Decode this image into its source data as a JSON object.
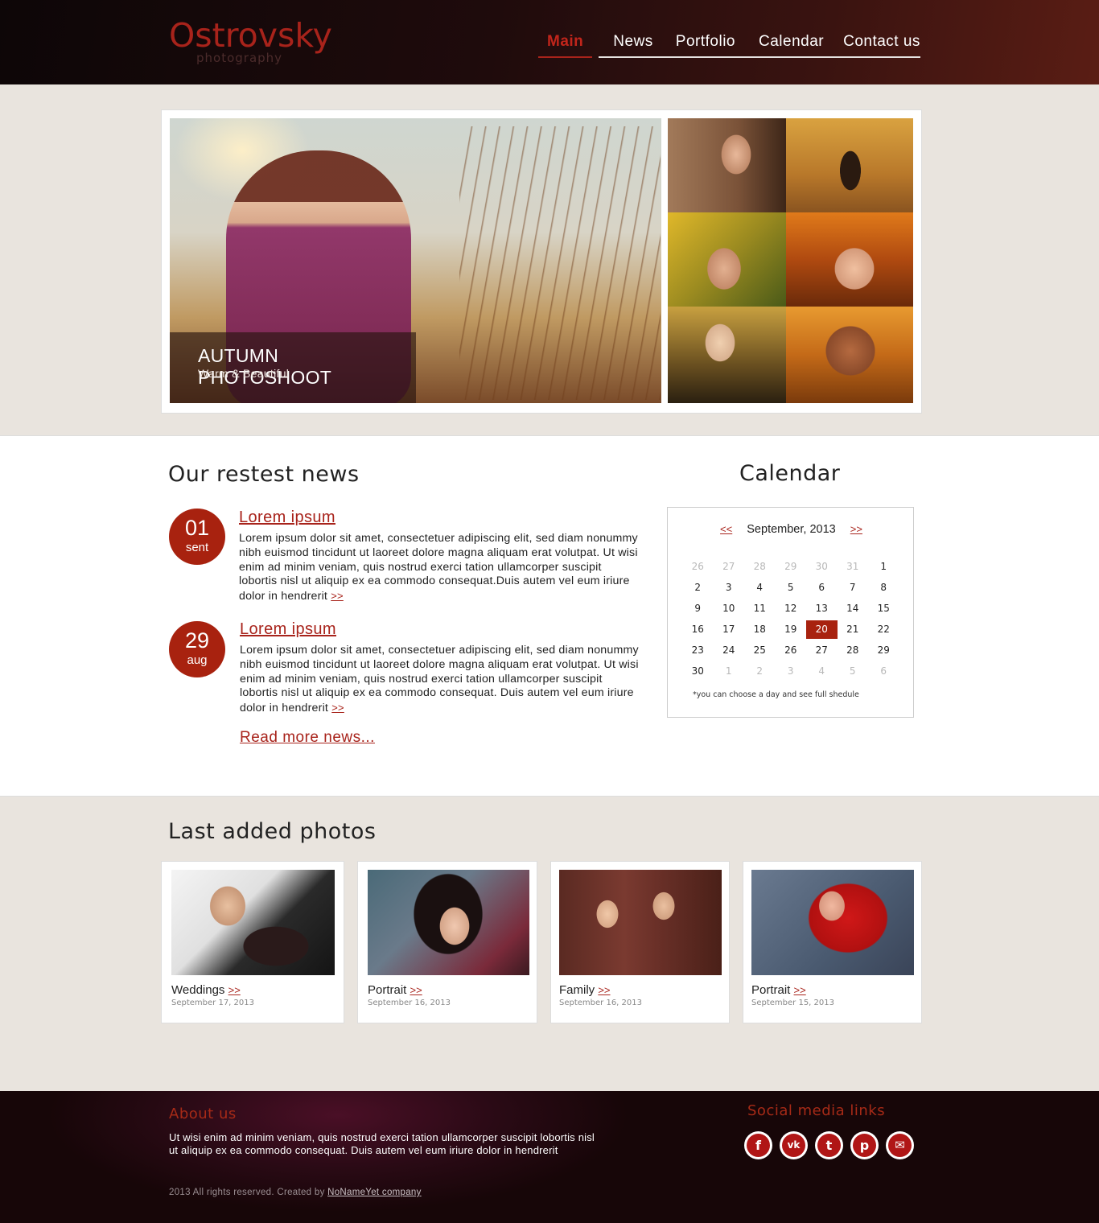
{
  "brand": {
    "name": "Ostrovsky",
    "tagline": "photography"
  },
  "nav": {
    "items": [
      {
        "label": "Main"
      },
      {
        "label": "News"
      },
      {
        "label": "Portfolio"
      },
      {
        "label": "Calendar"
      },
      {
        "label": "Contact us"
      }
    ],
    "active": "Main"
  },
  "hero": {
    "title": "AUTUMN PHOTOSHOOT",
    "subtitle": "Warm & Beautiful"
  },
  "news": {
    "heading": "Our restest news",
    "items": [
      {
        "day": "01",
        "month": "sent",
        "title": "Lorem ipsum",
        "body": "Lorem ipsum dolor sit amet, consectetuer adipiscing elit, sed diam nonummy nibh euismod tincidunt ut laoreet dolore magna aliquam erat volutpat. Ut wisi enim ad minim veniam, quis nostrud exerci tation ullamcorper suscipit lobortis nisl ut aliquip ex ea commodo consequat.Duis autem vel eum iriure dolor in hendrerit",
        "more": ">>"
      },
      {
        "day": "29",
        "month": "aug",
        "title": "Lorem ipsum",
        "body": "Lorem ipsum dolor sit amet, consectetuer adipiscing elit, sed diam nonummy nibh euismod tincidunt ut laoreet dolore magna aliquam erat volutpat. Ut wisi enim ad minim veniam, quis nostrud exerci tation ullamcorper suscipit lobortis nisl ut aliquip ex ea commodo consequat. Duis autem vel eum iriure dolor in hendrerit",
        "more": ">>"
      }
    ],
    "read_more": "Read more news..."
  },
  "calendar": {
    "heading": "Calendar",
    "prev": "<<",
    "next": ">>",
    "month_label": "September, 2013",
    "weeks": [
      [
        {
          "d": "26",
          "m": true
        },
        {
          "d": "27",
          "m": true
        },
        {
          "d": "28",
          "m": true
        },
        {
          "d": "29",
          "m": true
        },
        {
          "d": "30",
          "m": true
        },
        {
          "d": "31",
          "m": true
        },
        {
          "d": "1"
        }
      ],
      [
        {
          "d": "2"
        },
        {
          "d": "3"
        },
        {
          "d": "4"
        },
        {
          "d": "5"
        },
        {
          "d": "6"
        },
        {
          "d": "7"
        },
        {
          "d": "8"
        }
      ],
      [
        {
          "d": "9"
        },
        {
          "d": "10"
        },
        {
          "d": "11"
        },
        {
          "d": "12"
        },
        {
          "d": "13"
        },
        {
          "d": "14"
        },
        {
          "d": "15"
        }
      ],
      [
        {
          "d": "16"
        },
        {
          "d": "17"
        },
        {
          "d": "18"
        },
        {
          "d": "19"
        },
        {
          "d": "20",
          "t": true
        },
        {
          "d": "21"
        },
        {
          "d": "22"
        }
      ],
      [
        {
          "d": "23"
        },
        {
          "d": "24"
        },
        {
          "d": "25"
        },
        {
          "d": "26"
        },
        {
          "d": "27"
        },
        {
          "d": "28"
        },
        {
          "d": "29"
        }
      ],
      [
        {
          "d": "30"
        },
        {
          "d": "1",
          "m": true
        },
        {
          "d": "2",
          "m": true
        },
        {
          "d": "3",
          "m": true
        },
        {
          "d": "4",
          "m": true
        },
        {
          "d": "5",
          "m": true
        },
        {
          "d": "6",
          "m": true
        }
      ]
    ],
    "selected_day": "20",
    "note": "*you can choose a day and see full shedule"
  },
  "photos": {
    "heading": "Last added photos",
    "items": [
      {
        "category": "Weddings",
        "more": ">>",
        "date": "September 17, 2013"
      },
      {
        "category": "Portrait",
        "more": ">>",
        "date": "September 16, 2013"
      },
      {
        "category": "Family",
        "more": ">>",
        "date": "September 16, 2013"
      },
      {
        "category": "Portrait",
        "more": ">>",
        "date": "September 15, 2013"
      }
    ]
  },
  "footer": {
    "about_heading": "About us",
    "about_text": "Ut wisi enim ad minim veniam, quis nostrud exerci tation ullamcorper suscipit lobortis nisl ut aliquip ex ea commodo consequat. Duis autem vel eum iriure dolor in hendrerit",
    "copyright": "2013 All rights reserved. Created by",
    "creator_link": "NoNameYet company",
    "social_heading": "Social media links",
    "social": [
      {
        "icon": "facebook-icon",
        "glyph": "f"
      },
      {
        "icon": "vk-icon",
        "glyph": "vk"
      },
      {
        "icon": "twitter-icon",
        "glyph": "t"
      },
      {
        "icon": "pinterest-icon",
        "glyph": "p"
      },
      {
        "icon": "mail-icon",
        "glyph": "✉"
      }
    ]
  },
  "colors": {
    "accent": "#a8231b",
    "background": "#e9e4de",
    "header_dark": "#1f0b0c",
    "footer_dark": "#2a0a15"
  }
}
